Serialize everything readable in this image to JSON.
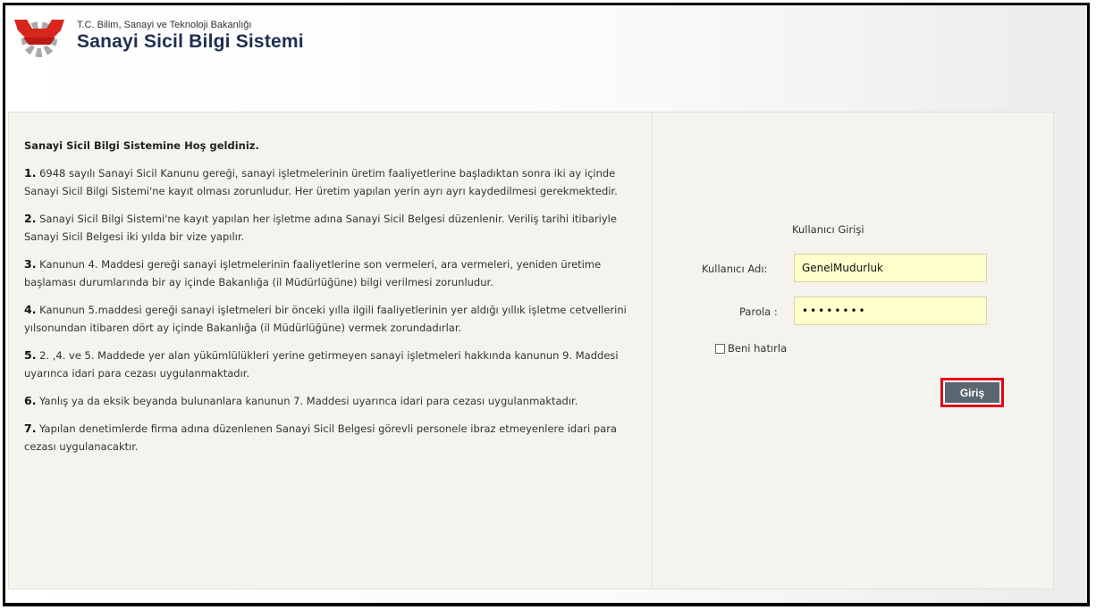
{
  "header": {
    "ministry": "T.C. Bilim, Sanayi ve Teknoloji Bakanlığı",
    "system_title": "Sanayi Sicil Bilgi Sistemi",
    "logo_icon": "gear-logo-icon",
    "colors": {
      "logo_red": "#d7261e",
      "logo_gray": "#a9a9a9",
      "title": "#1e2f50"
    }
  },
  "info": {
    "welcome": "Sanayi Sicil Bilgi Sistemine Hoş geldiniz.",
    "items": [
      {
        "num": "1.",
        "text": " 6948 sayılı Sanayi Sicil Kanunu gereği, sanayi işletmelerinin üretim faaliyetlerine başladıktan sonra iki ay içinde Sanayi Sicil Bilgi Sistemi'ne kayıt olması zorunludur. Her üretim yapılan yerin ayrı ayrı kaydedilmesi gerekmektedir."
      },
      {
        "num": "2.",
        "text": " Sanayi Sicil Bilgi Sistemi'ne kayıt yapılan her işletme adına Sanayi Sicil Belgesi düzenlenir. Veriliş tarihi itibariyle Sanayi Sicil Belgesi iki yılda bir vize yapılır."
      },
      {
        "num": "3.",
        "text": " Kanunun 4. Maddesi gereği sanayi işletmelerinin faaliyetlerine son vermeleri, ara vermeleri, yeniden üretime başlaması durumlarında bir ay içinde Bakanlığa (il Müdürlüğüne) bilgi verilmesi zorunludur."
      },
      {
        "num": "4.",
        "text": " Kanunun 5.maddesi gereği sanayi işletmeleri bir önceki yılla ilgili faaliyetlerinin yer aldığı yıllık işletme cetvellerini yılsonundan itibaren dört ay içinde Bakanlığa (il Müdürlüğüne) vermek zorundadırlar."
      },
      {
        "num": "5.",
        "text": " 2. ,4. ve 5. Maddede yer alan yükümlülükleri yerine getirmeyen sanayi işletmeleri hakkında kanunun 9. Maddesi uyarınca idari para cezası uygulanmaktadır."
      },
      {
        "num": "6.",
        "text": " Yanlış ya da eksik beyanda bulunanlara kanunun 7. Maddesi uyarınca idari para cezası uygulanmaktadır."
      },
      {
        "num": "7.",
        "text": " Yapılan denetimlerde firma adına düzenlenen Sanayi Sicil Belgesi görevli personele ibraz etmeyenlere idari para cezası uygulanacaktır."
      }
    ]
  },
  "login": {
    "title": "Kullanıcı Girişi",
    "username_label": "Kullanıcı Adı:",
    "username_value": "GenelMudurluk",
    "password_label": "Parola :",
    "password_value": "••••••••",
    "remember_label": "Beni hatırla",
    "remember_checked": false,
    "submit_label": "Giriş",
    "colors": {
      "input_bg": "#ffffcc",
      "button_bg": "#5a6670",
      "highlight": "#e0001a"
    }
  }
}
